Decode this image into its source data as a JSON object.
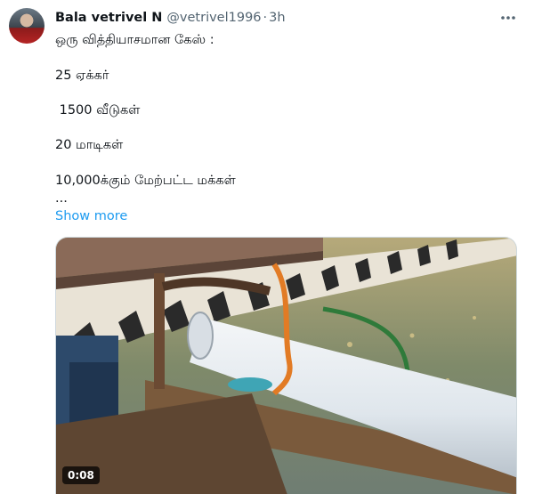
{
  "tweet": {
    "author_name": "Bala vetrivel N",
    "author_handle": "@vetrivel1996",
    "separator": "·",
    "time": "3h",
    "more_icon": "ellipsis-icon",
    "lines": [
      "ஒரு வித்தியாசமான கேஸ் :",
      "25 ஏக்கர்",
      " 1500 வீடுகள்",
      "20 மாடிகள்",
      "10,000க்கும் மேற்பட்ட மக்கள்",
      "..."
    ],
    "show_more": "Show more"
  },
  "media": {
    "type": "video",
    "duration": "0:08"
  }
}
